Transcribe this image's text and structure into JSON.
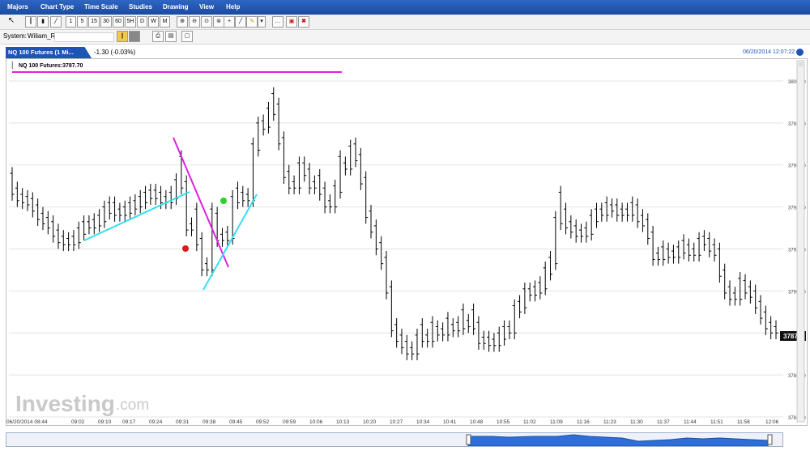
{
  "menu": {
    "items": [
      "Majors",
      "Chart Type",
      "Time Scale",
      "Studies",
      "Drawing",
      "View",
      "Help"
    ]
  },
  "toolbar": {
    "buttons": [
      "1",
      "5",
      "15",
      "30",
      "60",
      "5H",
      "D",
      "W",
      "M"
    ]
  },
  "system": {
    "label": "System:",
    "value": "Wiliam_R"
  },
  "tab": {
    "label": "NQ 100 Futures (1 Mi...",
    "change": "-1.30 (-0.03%)",
    "datetime": "06/20/2014 12:07:22"
  },
  "chart_data": {
    "type": "ohlc",
    "legend": "NQ 100 Futures:3787.70",
    "last_price_label": "3787.7",
    "last_price": 3787.7,
    "ylim": [
      3784,
      3800.5
    ],
    "yticks": [
      "3800.00",
      "3798.00",
      "3796.00",
      "3794.00",
      "3792.00",
      "3790.00",
      "3788.00",
      "3786.00",
      "3784.00"
    ],
    "xticks": [
      "06/20/2014 08:44",
      "09:02",
      "09:10",
      "09:17",
      "09:24",
      "09:31",
      "09:38",
      "09:45",
      "09:52",
      "09:59",
      "10:06",
      "10:13",
      "10:20",
      "10:27",
      "10:34",
      "10:41",
      "10:48",
      "10:55",
      "11:02",
      "11:09",
      "11:16",
      "11:23",
      "11:30",
      "11:37",
      "11:44",
      "11:51",
      "11:58",
      "12:06"
    ],
    "grid": true,
    "watermark": "Investing.com",
    "colors": {
      "bars": "#000000",
      "magenta": "#e020e0",
      "cyan": "#33e0ee",
      "red_marker": "#e01818",
      "green_marker": "#2bd12b",
      "accent": "#1d54b5"
    },
    "highs": [
      3795.9,
      3795.2,
      3794.9,
      3794.8,
      3794.7,
      3794.4,
      3794,
      3793.8,
      3793.6,
      3793.2,
      3792.9,
      3792.8,
      3792.9,
      3793.3,
      3793.6,
      3793.6,
      3793.7,
      3793.9,
      3794.3,
      3794.5,
      3794.5,
      3794.2,
      3794.3,
      3794.5,
      3794.6,
      3794.8,
      3795,
      3795.1,
      3795.1,
      3795,
      3794.8,
      3795,
      3795.6,
      3796.7,
      3795.5,
      3793.5,
      3794.2,
      3792.8,
      3791.6,
      3794.2,
      3794,
      3793,
      3793.1,
      3794.8,
      3795.2,
      3795,
      3794.9,
      3797.3,
      3798.3,
      3798.4,
      3799,
      3799.7,
      3799.2,
      3797.6,
      3796,
      3795.5,
      3796.4,
      3796.4,
      3796.1,
      3795.5,
      3795.8,
      3795.2,
      3794.6,
      3795.3,
      3796.7,
      3796.4,
      3797.2,
      3797.3,
      3796.8,
      3795.7,
      3794.1,
      3793.4,
      3792.6,
      3791.9,
      3790.5,
      3788.7,
      3788.2,
      3787.9,
      3787.6,
      3788.2,
      3788.7,
      3788.2,
      3788.8,
      3788.6,
      3788.5,
      3789,
      3788.7,
      3788.8,
      3789.4,
      3788.9,
      3789.4,
      3788.8,
      3788.1,
      3788.1,
      3788,
      3788.3,
      3788.6,
      3788.6,
      3789.6,
      3789.8,
      3790.4,
      3790.4,
      3790.5,
      3790.7,
      3791.4,
      3791.9,
      3793.8,
      3795,
      3794.2,
      3793.6,
      3793.4,
      3793.2,
      3793.3,
      3793.9,
      3794.2,
      3794.2,
      3794.5,
      3794.4,
      3794.4,
      3794.2,
      3794.2,
      3794.5,
      3794.4,
      3793.9,
      3793.7,
      3793.1,
      3792.1,
      3792.4,
      3792.3,
      3792.2,
      3792.4,
      3792.7,
      3792.5,
      3792.3,
      3792.8,
      3792.9,
      3792.8,
      3792.5,
      3792.3,
      3791.3,
      3790.5,
      3790.2,
      3790.9,
      3790.8,
      3790.5,
      3790.3,
      3789.8,
      3789.3,
      3788.8,
      3788.6
    ]
  }
}
